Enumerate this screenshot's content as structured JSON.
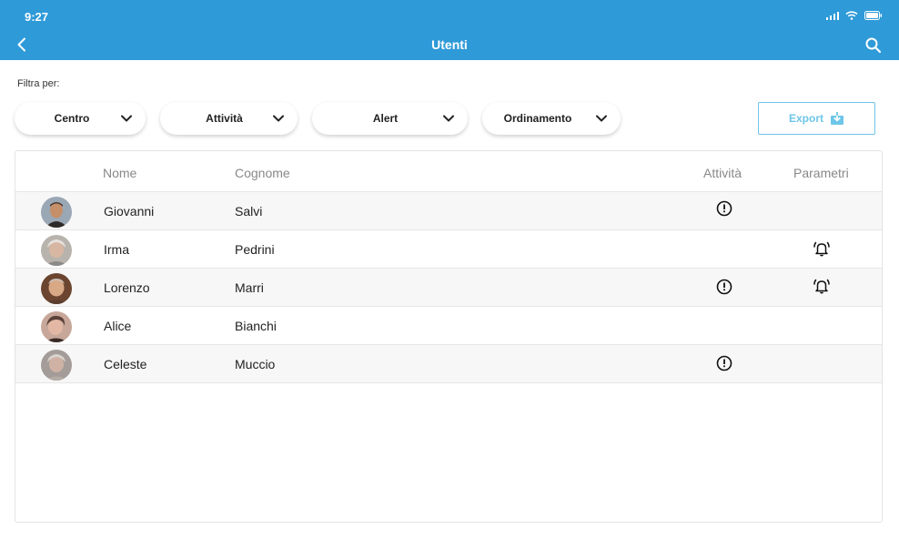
{
  "status": {
    "time": "9:27"
  },
  "header": {
    "title": "Utenti"
  },
  "filters": {
    "label": "Filtra per:",
    "items": [
      {
        "label": "Centro"
      },
      {
        "label": "Attività"
      },
      {
        "label": "Alert"
      },
      {
        "label": "Ordinamento"
      }
    ],
    "export_label": "Export"
  },
  "colors": {
    "header": "#2e9ad8",
    "export": "#6ec6e8"
  },
  "table": {
    "columns": {
      "name": "Nome",
      "surname": "Cognome",
      "activity": "Attività",
      "parameters": "Parametri"
    },
    "rows": [
      {
        "name": "Giovanni",
        "surname": "Salvi",
        "activity_alert": true,
        "parameter_alarm": false,
        "avatar": "avatar-photo-giovanni"
      },
      {
        "name": "Irma",
        "surname": "Pedrini",
        "activity_alert": false,
        "parameter_alarm": true,
        "avatar": "avatar-photo-irma"
      },
      {
        "name": "Lorenzo",
        "surname": "Marri",
        "activity_alert": true,
        "parameter_alarm": true,
        "avatar": "avatar-photo-lorenzo"
      },
      {
        "name": "Alice",
        "surname": "Bianchi",
        "activity_alert": false,
        "parameter_alarm": false,
        "avatar": "avatar-photo-alice"
      },
      {
        "name": "Celeste",
        "surname": "Muccio",
        "activity_alert": true,
        "parameter_alarm": false,
        "avatar": "avatar-photo-celeste"
      }
    ]
  }
}
